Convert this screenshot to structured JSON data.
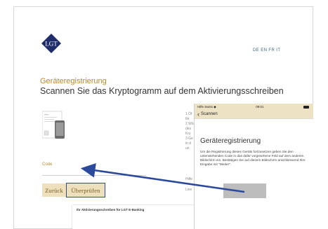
{
  "header": {
    "languages": "DE EN FR IT"
  },
  "content": {
    "kicker": "Geräteregistrierung",
    "headline": "Scannen Sie das Kryptogramm auf dem Aktivierungsschreiben",
    "code_label": "Code",
    "instr_numbers": "1 Öf\nthr\n2 Wä\ndes\nKry\n3 Ge\nin d\nun",
    "fine_1": "Hilfe",
    "fine_2": "Live"
  },
  "buttons": {
    "back": "Zurück",
    "check": "Überprüfen"
  },
  "pdf_preview": {
    "title": "Ihr Aktivierungsschreiben für LGT E-Banking"
  },
  "phone": {
    "status_left": "Hilfe Swiss ◆",
    "status_time": "09:01",
    "back_label": "Scannen",
    "title": "Geräteregistrierung",
    "body": "Um die Registrierung dieses Geräts fortzusetzen geben Sie den untenstehenden Code in das dafür vorgesehene Feld auf dem anderen Bildschirm ein. Bestätigen Sie auf diesem Bildschirm anschliessend Ihre Eingabe mit \"Weiter\"."
  },
  "colors": {
    "brand_gold": "#b48a2f",
    "brand_navy": "#1f2d6a",
    "button_bg": "#eee0bd",
    "arrow": "#2b4a9c"
  },
  "icons": {
    "logo": "lgt-crest-logo",
    "arrow": "pointer-arrow"
  }
}
